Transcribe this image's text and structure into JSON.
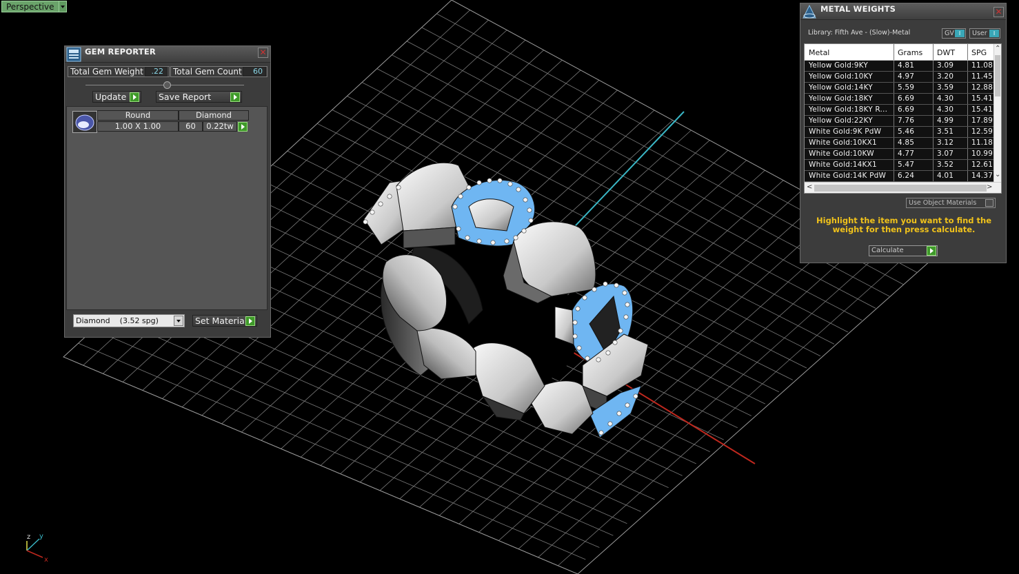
{
  "viewport": {
    "label": "Perspective",
    "axes": {
      "z": "z",
      "y": "y",
      "x": "x"
    }
  },
  "gem_reporter": {
    "title": "GEM REPORTER",
    "total_gem_weight_label": "Total Gem Weight",
    "total_gem_weight_value": ".22",
    "total_gem_count_label": "Total Gem Count",
    "total_gem_count_value": "60",
    "update_label": "Update",
    "save_report_label": "Save Report",
    "gem": {
      "shape": "Round",
      "material": "Diamond",
      "size": "1.00 X 1.00",
      "count": "60",
      "weight": "0.22tw"
    },
    "material_select_value": "Diamond    (3.52 spg)",
    "set_material_label": "Set Material"
  },
  "metal_weights": {
    "title": "METAL WEIGHTS",
    "library": "Library: Fifth Ave - (Slow)-Metal",
    "gv_label": "GV",
    "user_label": "User",
    "toggle_glyph": "I",
    "columns": [
      "Metal",
      "Grams",
      "DWT",
      "SPG"
    ],
    "rows": [
      [
        "Yellow Gold:9KY",
        "4.81",
        "3.09",
        "11.08"
      ],
      [
        "Yellow Gold:10KY",
        "4.97",
        "3.20",
        "11.45"
      ],
      [
        "Yellow Gold:14KY",
        "5.59",
        "3.59",
        "12.88"
      ],
      [
        "Yellow Gold:18KY",
        "6.69",
        "4.30",
        "15.41"
      ],
      [
        "Yellow Gold:18KY R...",
        "6.69",
        "4.30",
        "15.41"
      ],
      [
        "Yellow Gold:22KY",
        "7.76",
        "4.99",
        "17.89"
      ],
      [
        "White Gold:9K PdW",
        "5.46",
        "3.51",
        "12.59"
      ],
      [
        "White Gold:10KX1",
        "4.85",
        "3.12",
        "11.18"
      ],
      [
        "White Gold:10KW",
        "4.77",
        "3.07",
        "10.99"
      ],
      [
        "White Gold:14KX1",
        "5.47",
        "3.52",
        "12.61"
      ],
      [
        "White Gold:14K PdW",
        "6.24",
        "4.01",
        "14.37"
      ]
    ],
    "use_object_materials_label": "Use Object Materials",
    "hint": "Highlight the item you want to find the weight for then press calculate.",
    "calculate_label": "Calculate"
  },
  "colors": {
    "viewport_bg": "#000000",
    "grid": "#7a7a7a",
    "axis_y": "#3ab7c6",
    "axis_x": "#c0281e",
    "gem_blue": "#6fb6f2",
    "hint_text": "#f0c21b",
    "play_button": "#3f9a2a"
  }
}
